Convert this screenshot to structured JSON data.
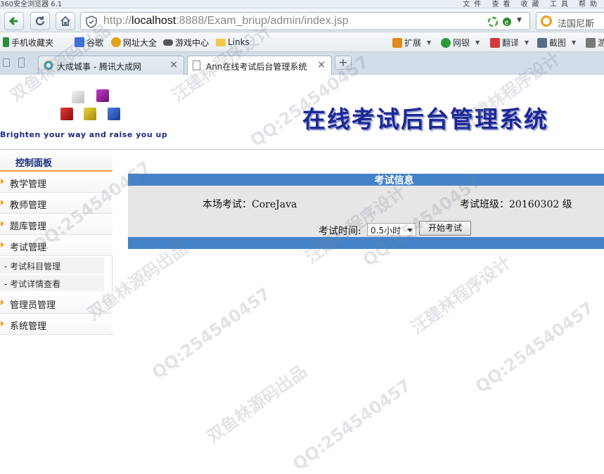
{
  "browser": {
    "title_bar": {
      "left": "360安全浏览器 6.1",
      "right": "文件 查看 收藏 工具 帮助"
    },
    "url": {
      "prefix": "http://",
      "host": "localhost",
      "rest": ":8888/Exam_briup/admin/index.jsp"
    },
    "search_text": "法国尼斯",
    "favorites": [
      {
        "label": "手机收藏夹",
        "color": "#2e8b3a"
      },
      {
        "label": "谷歌",
        "color": "#3b6fd8"
      },
      {
        "label": "网址大全",
        "color": "#e0a21a"
      },
      {
        "label": "游戏中心",
        "color": "#555555"
      },
      {
        "label": "Links",
        "color": "#f2c94c"
      }
    ],
    "tools": [
      {
        "label": "扩展",
        "color": "#e08b1a"
      },
      {
        "label": "网银",
        "color": "#2a9a3a"
      },
      {
        "label": "翻译",
        "color": "#d23b3b"
      },
      {
        "label": "截图",
        "color": "#5b6d86"
      },
      {
        "label": "游",
        "color": "#777777"
      }
    ],
    "tabs": [
      {
        "label": "大成城事 - 腾讯大成网",
        "close": "×"
      },
      {
        "label": "Ann在线考试后台管理系统",
        "close": "×"
      }
    ],
    "new_tab": "+"
  },
  "header": {
    "slogan": "Brighten your way and raise you up",
    "system_title": "在线考试后台管理系统"
  },
  "sidebar": {
    "panel_title": "控制面板",
    "items": [
      {
        "label": "教学管理"
      },
      {
        "label": "教师管理"
      },
      {
        "label": "题库管理"
      },
      {
        "label": "考试管理"
      }
    ],
    "sub_items": [
      {
        "label": "- 考试科目管理"
      },
      {
        "label": "- 考试详情查看"
      }
    ],
    "items_after": [
      {
        "label": "管理员管理"
      },
      {
        "label": "系统管理"
      }
    ]
  },
  "exam": {
    "heading": "考试信息",
    "current_exam_label": "本场考试：CoreJava",
    "class_label": "考试班级：20160302 级",
    "time_label": "考试时间:",
    "time_value": "0.5小时",
    "start_button": "开始考试"
  },
  "watermark": {
    "qq": "QQ:254540457",
    "a": "双鱼林源码出品",
    "b": "汪建林程序设计"
  }
}
